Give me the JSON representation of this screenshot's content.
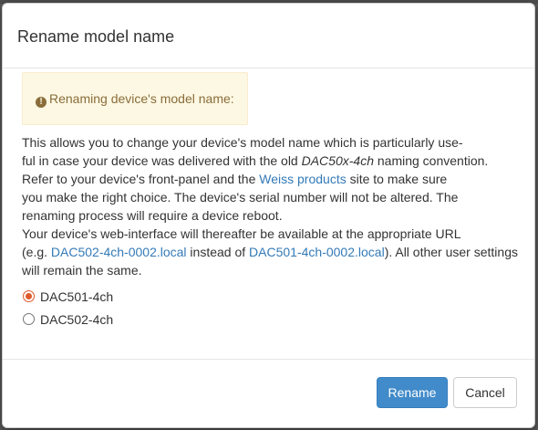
{
  "dialog": {
    "title": "Rename model name"
  },
  "alert": {
    "icon": "exclamation-circle-icon",
    "text": "Renaming device's model name:"
  },
  "body": {
    "l1": "This allows you to change your device's model name which is particularly use-",
    "l2a": "ful in case your device was delivered with the old ",
    "l2b": "DAC50x-4ch",
    "l2c": " naming convention.",
    "l3a": "Refer to your device's front-panel and the ",
    "l3link": "Weiss products",
    "l3b": " site to make sure",
    "l4": "you make the right choice. The device's serial number will not be altered. The",
    "l5": "renaming process will require a device reboot.",
    "l6": "Your device's web-interface will thereafter be available at the appropriate URL",
    "l7a": "(e.g. ",
    "l7link1": "DAC502-4ch-0002.local",
    "l7b": " instead of ",
    "l7link2": "DAC501-4ch-0002.local",
    "l7c": "). All other user settings",
    "l8": "will remain the same."
  },
  "options": [
    {
      "label": "DAC501-4ch",
      "selected": true
    },
    {
      "label": "DAC502-4ch",
      "selected": false
    }
  ],
  "footer": {
    "rename_label": "Rename",
    "cancel_label": "Cancel"
  },
  "colors": {
    "primary": "#428bca",
    "link": "#337ab7",
    "alert_bg": "#fcf8e3",
    "alert_text": "#8a6d3b",
    "radio_checked": "#e05a2b"
  }
}
